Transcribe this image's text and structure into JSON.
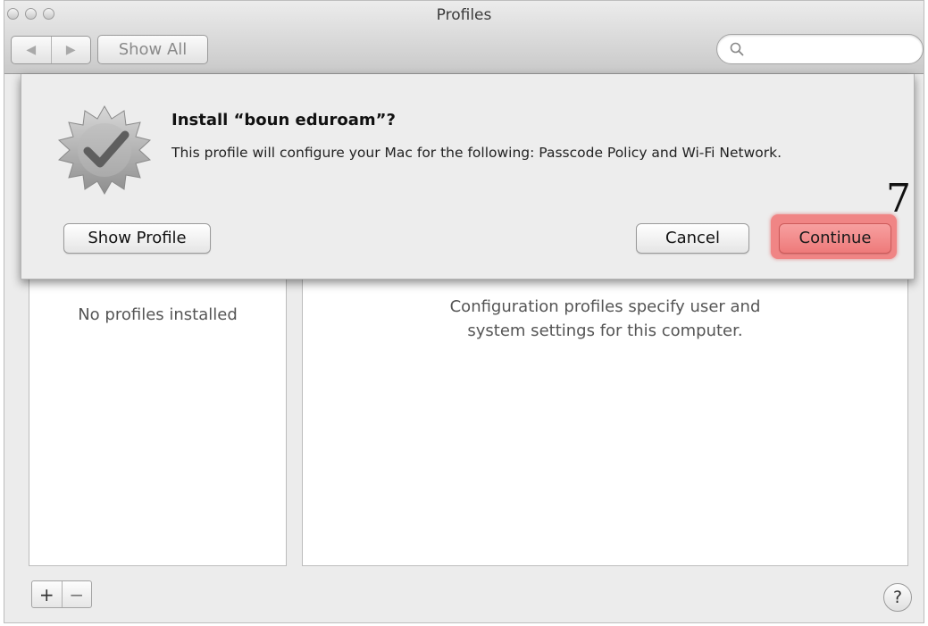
{
  "window": {
    "title": "Profiles"
  },
  "toolbar": {
    "back_glyph": "◀",
    "forward_glyph": "▶",
    "show_all_label": "Show All",
    "search_placeholder": ""
  },
  "sidebar": {
    "empty_text": "No profiles installed"
  },
  "detail": {
    "description": "Configuration profiles specify user and\nsystem settings for this computer."
  },
  "footer": {
    "add_label": "+",
    "remove_label": "−",
    "help_label": "?"
  },
  "dialog": {
    "title": "Install “boun eduroam”?",
    "message": "This profile will configure your Mac for the following: Passcode Policy and Wi-Fi Network.",
    "show_profile_label": "Show Profile",
    "cancel_label": "Cancel",
    "continue_label": "Continue",
    "step_marker": "7",
    "highlight_color": "#f08585"
  },
  "icons": [
    "close-icon",
    "minimize-icon",
    "zoom-icon",
    "back-arrow-icon",
    "forward-arrow-icon",
    "search-icon",
    "profile-badge-icon",
    "help-icon"
  ]
}
